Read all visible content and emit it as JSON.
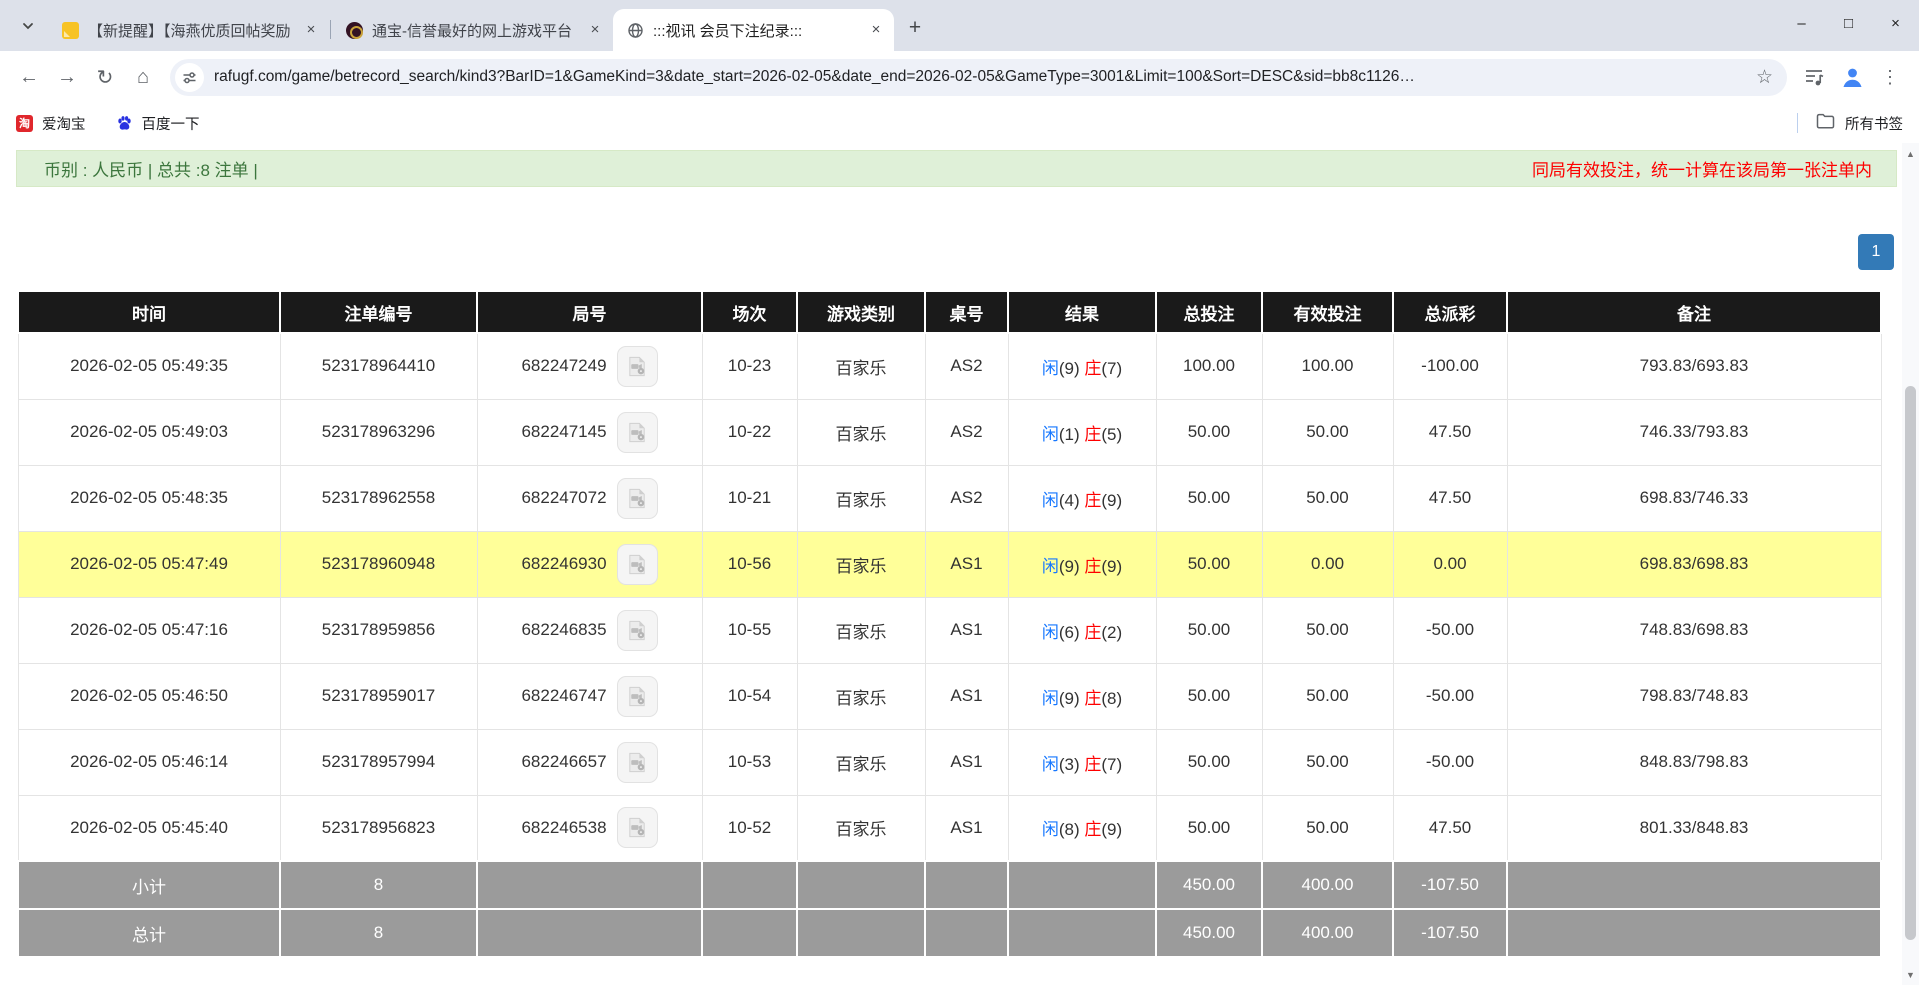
{
  "browser": {
    "tabs": [
      {
        "title": "【新提醒】【海燕优质回帖奖励",
        "active": false
      },
      {
        "title": "通宝-信誉最好的网上游戏平台",
        "active": false
      },
      {
        "title": ":::视讯 会员下注纪录:::",
        "active": true
      }
    ],
    "url": "rafugf.com/game/betrecord_search/kind3?BarID=1&GameKind=3&date_start=2026-02-05&date_end=2026-02-05&GameType=3001&Limit=100&Sort=DESC&sid=bb8c1126…",
    "bookmarks": [
      {
        "label": "爱淘宝",
        "icon_char": "淘"
      },
      {
        "label": "百度一下"
      }
    ],
    "all_bookmarks_label": "所有书签"
  },
  "icons": {
    "close": "×",
    "new_tab": "+",
    "back": "←",
    "forward": "→",
    "reload": "↻",
    "home": "⌂",
    "star": "☆",
    "menu": "⋮",
    "minimize": "–",
    "maximize": "□",
    "window_close": "×",
    "scroll_up": "▲",
    "scroll_down": "▼"
  },
  "page": {
    "summary_bar": {
      "text": "币别 : 人民币 | 总共 :8 注单 |",
      "note": "同局有效投注，统一计算在该局第一张注单内"
    },
    "pagination": {
      "current": "1"
    },
    "table": {
      "headers": [
        "时间",
        "注单编号",
        "局号",
        "场次",
        "游戏类别",
        "桌号",
        "结果",
        "总投注",
        "有效投注",
        "总派彩",
        "备注"
      ],
      "result_labels": {
        "player": "闲",
        "banker": "庄"
      },
      "rows": [
        {
          "time": "2026-02-05 05:49:35",
          "bet_id": "523178964410",
          "round_id": "682247249",
          "session": "10-23",
          "game_type": "百家乐",
          "table_no": "AS2",
          "player": "(9)",
          "banker": "(7)",
          "bet": "100.00",
          "valid_bet": "100.00",
          "payout": "-100.00",
          "note": "793.83/693.83",
          "highlight": false
        },
        {
          "time": "2026-02-05 05:49:03",
          "bet_id": "523178963296",
          "round_id": "682247145",
          "session": "10-22",
          "game_type": "百家乐",
          "table_no": "AS2",
          "player": "(1)",
          "banker": "(5)",
          "bet": "50.00",
          "valid_bet": "50.00",
          "payout": "47.50",
          "note": "746.33/793.83",
          "highlight": false
        },
        {
          "time": "2026-02-05 05:48:35",
          "bet_id": "523178962558",
          "round_id": "682247072",
          "session": "10-21",
          "game_type": "百家乐",
          "table_no": "AS2",
          "player": "(4)",
          "banker": "(9)",
          "bet": "50.00",
          "valid_bet": "50.00",
          "payout": "47.50",
          "note": "698.83/746.33",
          "highlight": false
        },
        {
          "time": "2026-02-05 05:47:49",
          "bet_id": "523178960948",
          "round_id": "682246930",
          "session": "10-56",
          "game_type": "百家乐",
          "table_no": "AS1",
          "player": "(9)",
          "banker": "(9)",
          "bet": "50.00",
          "valid_bet": "0.00",
          "payout": "0.00",
          "note": "698.83/698.83",
          "highlight": true
        },
        {
          "time": "2026-02-05 05:47:16",
          "bet_id": "523178959856",
          "round_id": "682246835",
          "session": "10-55",
          "game_type": "百家乐",
          "table_no": "AS1",
          "player": "(6)",
          "banker": "(2)",
          "bet": "50.00",
          "valid_bet": "50.00",
          "payout": "-50.00",
          "note": "748.83/698.83",
          "highlight": false
        },
        {
          "time": "2026-02-05 05:46:50",
          "bet_id": "523178959017",
          "round_id": "682246747",
          "session": "10-54",
          "game_type": "百家乐",
          "table_no": "AS1",
          "player": "(9)",
          "banker": "(8)",
          "bet": "50.00",
          "valid_bet": "50.00",
          "payout": "-50.00",
          "note": "798.83/748.83",
          "highlight": false
        },
        {
          "time": "2026-02-05 05:46:14",
          "bet_id": "523178957994",
          "round_id": "682246657",
          "session": "10-53",
          "game_type": "百家乐",
          "table_no": "AS1",
          "player": "(3)",
          "banker": "(7)",
          "bet": "50.00",
          "valid_bet": "50.00",
          "payout": "-50.00",
          "note": "848.83/798.83",
          "highlight": false
        },
        {
          "time": "2026-02-05 05:45:40",
          "bet_id": "523178956823",
          "round_id": "682246538",
          "session": "10-52",
          "game_type": "百家乐",
          "table_no": "AS1",
          "player": "(8)",
          "banker": "(9)",
          "bet": "50.00",
          "valid_bet": "50.00",
          "payout": "47.50",
          "note": "801.33/848.83",
          "highlight": false
        }
      ],
      "footer": [
        {
          "label": "小计",
          "count": "8",
          "bet": "450.00",
          "valid_bet": "400.00",
          "payout": "-107.50"
        },
        {
          "label": "总计",
          "count": "8",
          "bet": "450.00",
          "valid_bet": "400.00",
          "payout": "-107.50"
        }
      ]
    }
  },
  "colors": {
    "accent_blue": "#1677ff",
    "negative_red": "#fe0000",
    "success_bg": "#dff0d8",
    "success_text": "#3c763d",
    "pagination_blue": "#337ab7",
    "highlight_row": "#ffff99",
    "header_bg": "#1a1a1a",
    "footer_bg": "#9b9b9b"
  }
}
